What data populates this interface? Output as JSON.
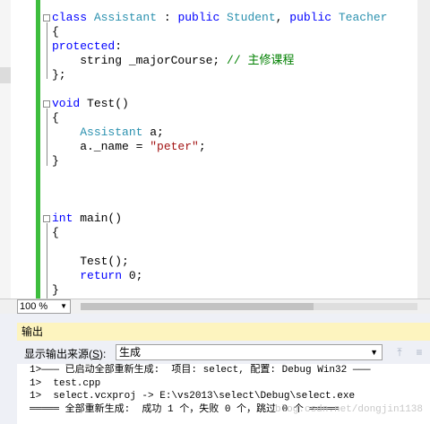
{
  "editor": {
    "lines": [
      [
        {
          "t": "class ",
          "c": "kw"
        },
        {
          "t": "Assistant",
          "c": "ty"
        },
        {
          "t": " : ",
          "c": ""
        },
        {
          "t": "public ",
          "c": "kw"
        },
        {
          "t": "Student",
          "c": "ty"
        },
        {
          "t": ", ",
          "c": ""
        },
        {
          "t": "public ",
          "c": "kw"
        },
        {
          "t": "Teacher",
          "c": "ty"
        }
      ],
      [
        {
          "t": "{",
          "c": ""
        }
      ],
      [
        {
          "t": "protected",
          "c": "kw"
        },
        {
          "t": ":",
          "c": ""
        }
      ],
      [
        {
          "t": "    string _majorCourse; ",
          "c": ""
        },
        {
          "t": "// 主修课程",
          "c": "cm"
        }
      ],
      [
        {
          "t": "};",
          "c": ""
        }
      ],
      [],
      [
        {
          "t": "void ",
          "c": "kw"
        },
        {
          "t": "Test()",
          "c": ""
        }
      ],
      [
        {
          "t": "{",
          "c": ""
        }
      ],
      [
        {
          "t": "    ",
          "c": ""
        },
        {
          "t": "Assistant",
          "c": "ty"
        },
        {
          "t": " a;",
          "c": ""
        }
      ],
      [
        {
          "t": "    a._name = ",
          "c": ""
        },
        {
          "t": "\"peter\"",
          "c": "st"
        },
        {
          "t": ";",
          "c": ""
        }
      ],
      [
        {
          "t": "}",
          "c": ""
        }
      ],
      [],
      [],
      [],
      [
        {
          "t": "int ",
          "c": "kw"
        },
        {
          "t": "main()",
          "c": ""
        }
      ],
      [
        {
          "t": "{",
          "c": ""
        }
      ],
      [],
      [
        {
          "t": "    Test();",
          "c": ""
        }
      ],
      [
        {
          "t": "    ",
          "c": ""
        },
        {
          "t": "return ",
          "c": "kw"
        },
        {
          "t": "0;",
          "c": ""
        }
      ],
      [
        {
          "t": "}",
          "c": ""
        }
      ]
    ]
  },
  "zoom": {
    "value": "100 %"
  },
  "output": {
    "title": "输出",
    "source_label_pre": "显示输出来源(",
    "source_label_key": "S",
    "source_label_post": "):",
    "source_value": "生成",
    "lines": [
      "1>——— 已启动全部重新生成:  项目: select, 配置: Debug Win32 ———",
      "1>  test.cpp",
      "1>  select.vcxproj -> E:\\vs2013\\select\\Debug\\select.exe",
      "═════ 全部重新生成:  成功 1 个，失败 0 个，跳过 0 个 ═════"
    ],
    "watermark": "blog.csdn.net/dongjin1138"
  }
}
